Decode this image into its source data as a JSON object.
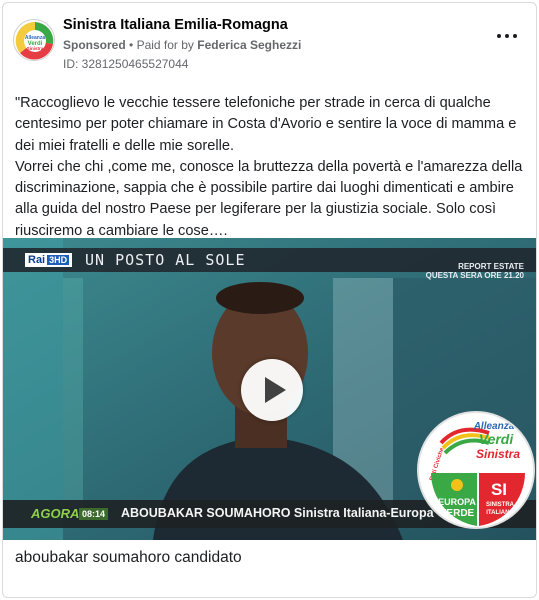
{
  "header": {
    "page_name": "Sinistra Italiana Emilia-Romagna",
    "sponsored": "Sponsored",
    "separator": "•",
    "paid_for_by": "Paid for by",
    "payer": "Federica Seghezzi",
    "ad_id": "ID: 3281250465527044",
    "avatar_text": [
      "Alleanza",
      "Verdi",
      "Sinistra"
    ]
  },
  "post_text": "\"Raccoglievo le vecchie tessere telefoniche per strade in cerca di qualche centesimo per poter chiamare in Costa d'Avorio e sentire la voce di mamma e dei miei fratelli e delle mie sorelle.\nVorrei che chi ,come me, conosce la bruttezza della povertà e l'amarezza della discriminazione, sappia che è possibile partire dai luoghi dimenticati e ambire alla guida del nostro Paese per legiferare per la giustizia sociale. Solo così riusciremo a cambiare le cose….",
  "video": {
    "broadcaster": "Rai",
    "channel": "3HD",
    "show_title": "UN POSTO AL SOLE",
    "promo_line1": "REPORT ESTATE",
    "promo_line2": "QUESTA SERA ORE 21.20",
    "program_logo": "AGORA",
    "program_time": "08:14",
    "lower_third": "ABOUBAKAR SOUMAHORO   Sinistra Italiana-Europa Verde"
  },
  "party_logo": {
    "top_line1": "Alleanza",
    "top_line2": "Verdi",
    "top_line3": "Sinistra",
    "side_text": "Reti Civiche",
    "left_line1": "EUROPA",
    "left_line2": "VERDE",
    "right_mark": "SI",
    "right_line1": "SINISTRA",
    "right_line2": "ITALIANA"
  },
  "caption": "aboubakar soumahoro candidato",
  "colors": {
    "green": "#3aa845",
    "red": "#e3272f",
    "yellow": "#f2c21a",
    "blue": "#2b67b3",
    "meta_gray": "#65676b"
  },
  "icons": {
    "more": "more-horizontal-icon",
    "play": "play-icon"
  }
}
